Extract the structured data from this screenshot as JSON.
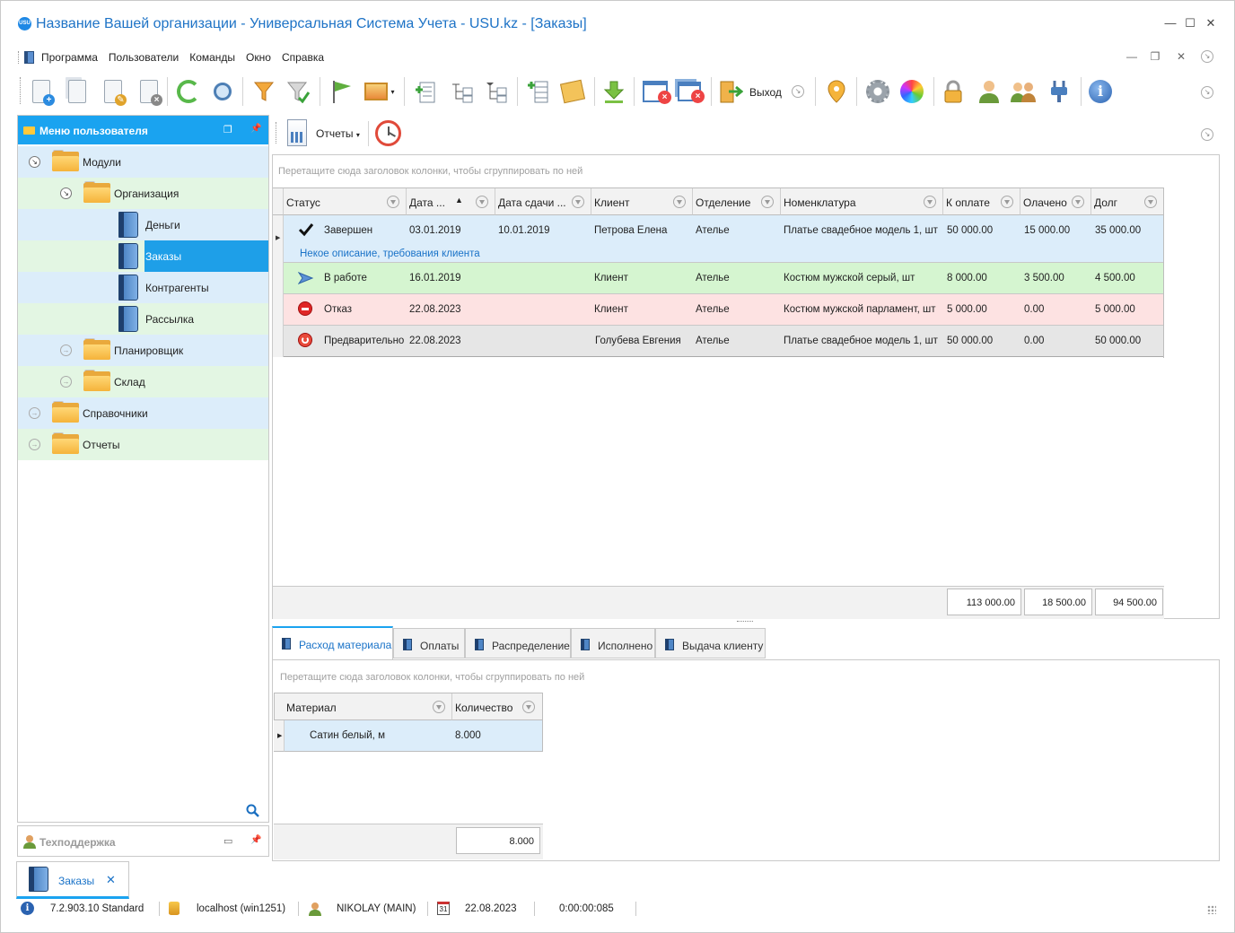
{
  "window": {
    "title": "Название Вашей организации - Универсальная Система Учета - USU.kz - [Заказы]",
    "logo_text": "USU",
    "controls": [
      "—",
      "☐",
      "✕"
    ]
  },
  "menu": {
    "items": [
      "Программа",
      "Пользователи",
      "Команды",
      "Окно",
      "Справка"
    ],
    "mdi_controls": [
      "—",
      "❐",
      "✕"
    ]
  },
  "toolbar": {
    "exit_label": "Выход",
    "icons": [
      "add-document-icon",
      "copy-document-icon",
      "edit-document-icon",
      "delete-document-icon",
      "refresh-icon",
      "search-icon",
      "filter-icon",
      "filter-check-icon",
      "flag-icon",
      "image-icon",
      "add-row-icon",
      "collapse-tree-icon",
      "expand-tree-icon",
      "insert-column-icon",
      "notes-icon",
      "download-icon",
      "close-window-icon",
      "close-all-windows-icon",
      "exit-icon",
      "location-pin-icon",
      "settings-gear-icon",
      "color-palette-icon",
      "lock-icon",
      "user-icon",
      "users-icon",
      "plugin-icon",
      "info-icon"
    ]
  },
  "left_panel": {
    "title": "Меню пользователя",
    "tree": [
      {
        "label": "Модули"
      },
      {
        "label": "Организация"
      },
      {
        "label": "Деньги"
      },
      {
        "label": "Заказы"
      },
      {
        "label": "Контрагенты"
      },
      {
        "label": "Рассылка"
      },
      {
        "label": "Планировщик"
      },
      {
        "label": "Склад"
      },
      {
        "label": "Справочники"
      },
      {
        "label": "Отчеты"
      }
    ],
    "support_title": "Техподдержка"
  },
  "reports_bar": {
    "reports_label": "Отчеты"
  },
  "orders_grid": {
    "group_hint": "Перетащите сюда заголовок колонки, чтобы сгруппировать по ней",
    "columns": [
      "Статус",
      "Дата ...",
      "Дата сдачи ...",
      "Клиент",
      "Отделение",
      "Номенклатура",
      "К оплате",
      "Олачено",
      "Долг"
    ],
    "rows": [
      {
        "status": "Завершен",
        "date": "03.01.2019",
        "due": "10.01.2019",
        "client": "Петрова Елена",
        "branch": "Ателье",
        "item": "Платье свадебное модель 1, шт",
        "to_pay": "50 000.00",
        "paid": "15 000.00",
        "debt": "35 000.00",
        "color": "#dcedfa",
        "icon": "check-icon"
      },
      {
        "status": "В работе",
        "date": "16.01.2019",
        "due": "",
        "client": "Клиент",
        "branch": "Ателье",
        "item": "Костюм мужской серый, шт",
        "to_pay": "8 000.00",
        "paid": "3 500.00",
        "debt": "4 500.00",
        "color": "#d5f5d0",
        "icon": "play-arrow-icon"
      },
      {
        "status": "Отказ",
        "date": "22.08.2023",
        "due": "",
        "client": "Клиент",
        "branch": "Ателье",
        "item": "Костюм мужской парламент, шт",
        "to_pay": "5 000.00",
        "paid": "0.00",
        "debt": "5 000.00",
        "color": "#fde2e2",
        "icon": "stop-icon"
      },
      {
        "status": "Предварительно",
        "date": "22.08.2023",
        "due": "",
        "client": "Голубева Евгения",
        "branch": "Ателье",
        "item": "Платье свадебное модель 1, шт",
        "to_pay": "50 000.00",
        "paid": "0.00",
        "debt": "50 000.00",
        "color": "#e6e6e6",
        "icon": "pending-icon"
      }
    ],
    "detail_text": "Некое описание, требования клиента",
    "totals": {
      "to_pay": "113 000.00",
      "paid": "18 500.00",
      "debt": "94 500.00"
    }
  },
  "bottom_tabs": {
    "tabs": [
      "Расход материала",
      "Оплаты",
      "Распределение",
      "Исполнено",
      "Выдача клиенту"
    ],
    "active": 0
  },
  "materials_grid": {
    "group_hint": "Перетащите сюда заголовок колонки, чтобы сгруппировать по ней",
    "columns": [
      "Материал",
      "Количество"
    ],
    "rows": [
      {
        "material": "Сатин белый, м",
        "qty": "8.000"
      }
    ],
    "total": "8.000"
  },
  "doc_tab": {
    "label": "Заказы",
    "close": "✕"
  },
  "status_bar": {
    "version": "7.2.903.10 Standard",
    "server": "localhost (win1251)",
    "user": "NIKOLAY (MAIN)",
    "calendar_day": "31",
    "date": "22.08.2023",
    "timer": "0:00:00:085"
  },
  "colors": {
    "accent": "#1aa3f0",
    "title": "#1e73c6",
    "selection": "#1e9fe8"
  }
}
